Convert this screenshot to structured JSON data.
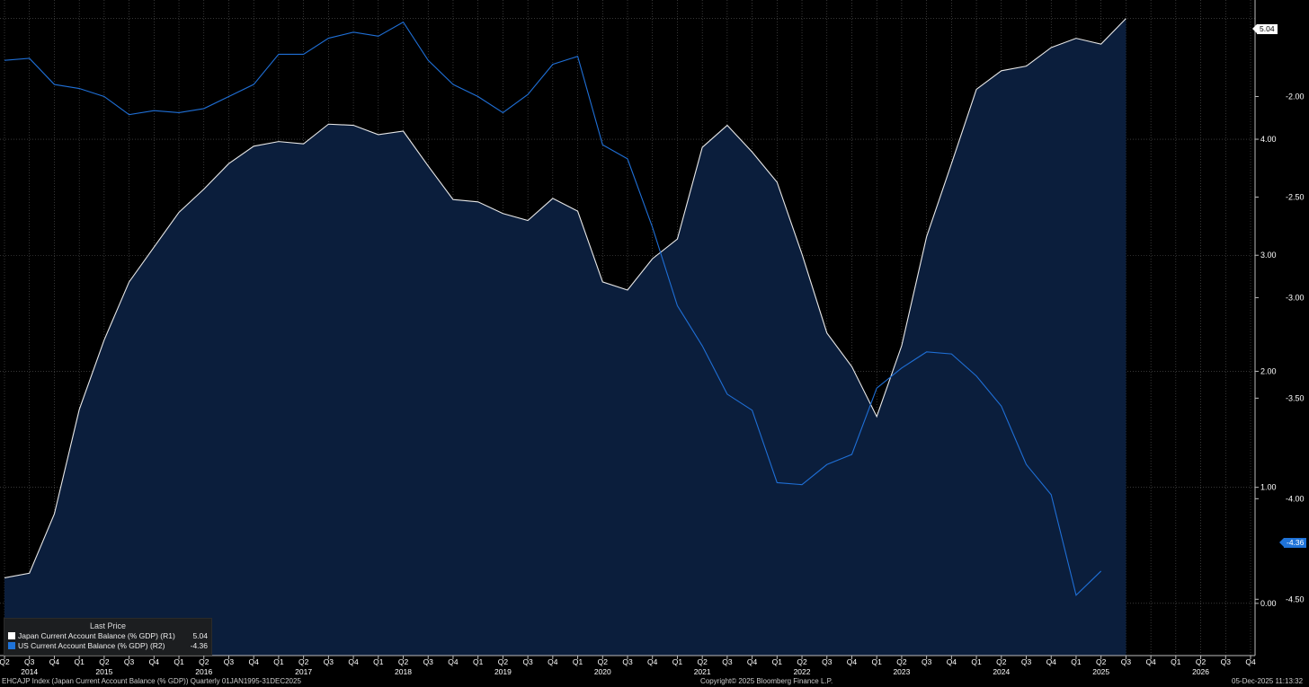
{
  "chart_data": {
    "type": "area",
    "title": "",
    "frequency": "Quarterly",
    "x": [
      "2014-Q2",
      "2014-Q3",
      "2014-Q4",
      "2015-Q1",
      "2015-Q2",
      "2015-Q3",
      "2015-Q4",
      "2016-Q1",
      "2016-Q2",
      "2016-Q3",
      "2016-Q4",
      "2017-Q1",
      "2017-Q2",
      "2017-Q3",
      "2017-Q4",
      "2018-Q1",
      "2018-Q2",
      "2018-Q3",
      "2018-Q4",
      "2019-Q1",
      "2019-Q2",
      "2019-Q3",
      "2019-Q4",
      "2020-Q1",
      "2020-Q2",
      "2020-Q3",
      "2020-Q4",
      "2021-Q1",
      "2021-Q2",
      "2021-Q3",
      "2021-Q4",
      "2022-Q1",
      "2022-Q2",
      "2022-Q3",
      "2022-Q4",
      "2023-Q1",
      "2023-Q2",
      "2023-Q3",
      "2023-Q4",
      "2024-Q1",
      "2024-Q2",
      "2024-Q3",
      "2024-Q4",
      "2025-Q1",
      "2025-Q2",
      "2025-Q3",
      "2025-Q4",
      "2026-Q1",
      "2026-Q2",
      "2026-Q3",
      "2026-Q4"
    ],
    "x_tick_quarters": [
      "Q2",
      "Q3",
      "Q4",
      "Q1",
      "Q2",
      "Q3",
      "Q4",
      "Q1",
      "Q2",
      "Q3",
      "Q4",
      "Q1",
      "Q2",
      "Q3",
      "Q4",
      "Q1",
      "Q2",
      "Q3",
      "Q4",
      "Q1",
      "Q2",
      "Q3",
      "Q4",
      "Q1",
      "Q2",
      "Q3",
      "Q4",
      "Q1",
      "Q2",
      "Q3",
      "Q4",
      "Q1",
      "Q2",
      "Q3",
      "Q4",
      "Q1",
      "Q2",
      "Q3",
      "Q4",
      "Q1",
      "Q2",
      "Q3",
      "Q4",
      "Q1",
      "Q2",
      "Q3",
      "Q4",
      "Q1",
      "Q2",
      "Q3",
      "Q4"
    ],
    "x_tick_years": [
      {
        "label": "2014",
        "quarter": "2014-Q3"
      },
      {
        "label": "2015",
        "quarter": "2015-Q2"
      },
      {
        "label": "2016",
        "quarter": "2016-Q2"
      },
      {
        "label": "2017",
        "quarter": "2017-Q2"
      },
      {
        "label": "2018",
        "quarter": "2018-Q2"
      },
      {
        "label": "2019",
        "quarter": "2019-Q2"
      },
      {
        "label": "2020",
        "quarter": "2020-Q2"
      },
      {
        "label": "2021",
        "quarter": "2021-Q2"
      },
      {
        "label": "2022",
        "quarter": "2022-Q2"
      },
      {
        "label": "2023",
        "quarter": "2023-Q2"
      },
      {
        "label": "2024",
        "quarter": "2024-Q2"
      },
      {
        "label": "2025",
        "quarter": "2025-Q2"
      },
      {
        "label": "2026",
        "quarter": "2026-Q2"
      }
    ],
    "axis_r1": {
      "range": [
        -0.45,
        5.2
      ],
      "ticks": [
        0.0,
        1.0,
        2.0,
        3.0,
        4.0
      ],
      "tick_labels": [
        "0.00",
        "1.00",
        "2.00",
        "3.00",
        "4.00"
      ]
    },
    "axis_r2": {
      "range": [
        -4.78,
        -1.52
      ],
      "ticks": [
        -2.0,
        -2.5,
        -3.0,
        -3.5,
        -4.0,
        -4.5
      ],
      "tick_labels": [
        "-2.00",
        "-2.50",
        "-3.00",
        "-3.50",
        "-4.00",
        "-4.50"
      ]
    },
    "grid": true,
    "legend_position": "bottom-left",
    "series": [
      {
        "name": "Japan Current Account Balance (% GDP)",
        "axis": "R1",
        "style": "area",
        "values": [
          0.22,
          0.26,
          0.77,
          1.67,
          2.27,
          2.77,
          3.07,
          3.37,
          3.57,
          3.79,
          3.94,
          3.98,
          3.96,
          4.13,
          4.12,
          4.04,
          4.07,
          3.77,
          3.48,
          3.46,
          3.36,
          3.3,
          3.49,
          3.38,
          2.77,
          2.7,
          2.97,
          3.14,
          3.93,
          4.12,
          3.89,
          3.63,
          3.01,
          2.33,
          2.04,
          1.61,
          2.22,
          3.16,
          3.79,
          4.43,
          4.59,
          4.63,
          4.79,
          4.87,
          4.82,
          5.04
        ]
      },
      {
        "name": "US Current Account Balance (% GDP)",
        "axis": "R2",
        "style": "line",
        "values": [
          -1.82,
          -1.81,
          -1.94,
          -1.96,
          -2.0,
          -2.09,
          -2.07,
          -2.08,
          -2.06,
          -2.0,
          -1.94,
          -1.79,
          -1.79,
          -1.71,
          -1.68,
          -1.7,
          -1.63,
          -1.82,
          -1.94,
          -2.0,
          -2.08,
          -1.99,
          -1.84,
          -1.8,
          -2.24,
          -2.31,
          -2.65,
          -3.04,
          -3.24,
          -3.48,
          -3.56,
          -3.92,
          -3.93,
          -3.83,
          -3.78,
          -3.45,
          -3.35,
          -3.27,
          -3.28,
          -3.39,
          -3.54,
          -3.83,
          -3.98,
          -4.48,
          -4.36
        ]
      }
    ]
  },
  "legend": {
    "header": "Last Price",
    "items": [
      {
        "name": "Japan Current Account Balance (% GDP)",
        "axis_tag": "(R1)",
        "value": "5.04",
        "color": "#ffffff"
      },
      {
        "name": "US Current Account Balance (% GDP)",
        "axis_tag": "(R2)",
        "value": "-4.36",
        "color": "#1f73d8"
      }
    ]
  },
  "price_tags": {
    "japan": "5.04",
    "us": "-4.36"
  },
  "footer": {
    "left": "EHCAJP Index (Japan Current Account Balance (% GDP)) Quarterly 01JAN1995-31DEC2025",
    "center": "Copyright© 2025 Bloomberg Finance L.P.",
    "right": "05-Dec-2025 11:13:32"
  },
  "colors": {
    "background": "#000000",
    "area_fill": "#0b1e3c",
    "japan_line": "#e8e8e8",
    "us_line": "#1f6fd6",
    "grid": "#5a5a5a",
    "text": "#ffffff"
  }
}
